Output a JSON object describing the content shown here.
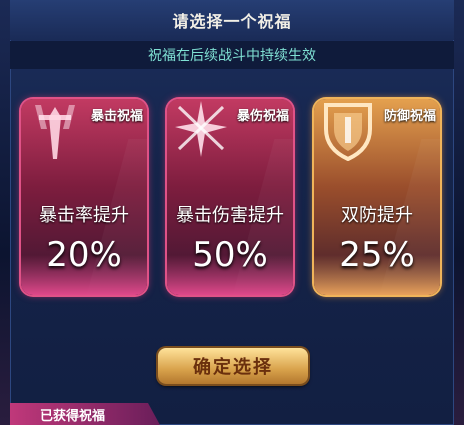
{
  "dialog": {
    "title": "请选择一个祝福",
    "subtitle": "祝福在后续战斗中持续生效"
  },
  "cards": [
    {
      "tag": "暴击祝福",
      "name": "暴击率提升",
      "value": "20%",
      "icon": "sword-icon",
      "theme": "red"
    },
    {
      "tag": "暴伤祝福",
      "name": "暴击伤害提升",
      "value": "50%",
      "icon": "star-burst-icon",
      "theme": "red"
    },
    {
      "tag": "防御祝福",
      "name": "双防提升",
      "value": "25%",
      "icon": "shield-icon",
      "theme": "gold"
    }
  ],
  "confirm_label": "确定选择",
  "footer": {
    "label": "已获得祝福"
  },
  "colors": {
    "red_card": "#c23a62",
    "gold_card": "#e4a04e",
    "subtitle": "#7fe0d3",
    "confirm": "#d8a24b"
  }
}
